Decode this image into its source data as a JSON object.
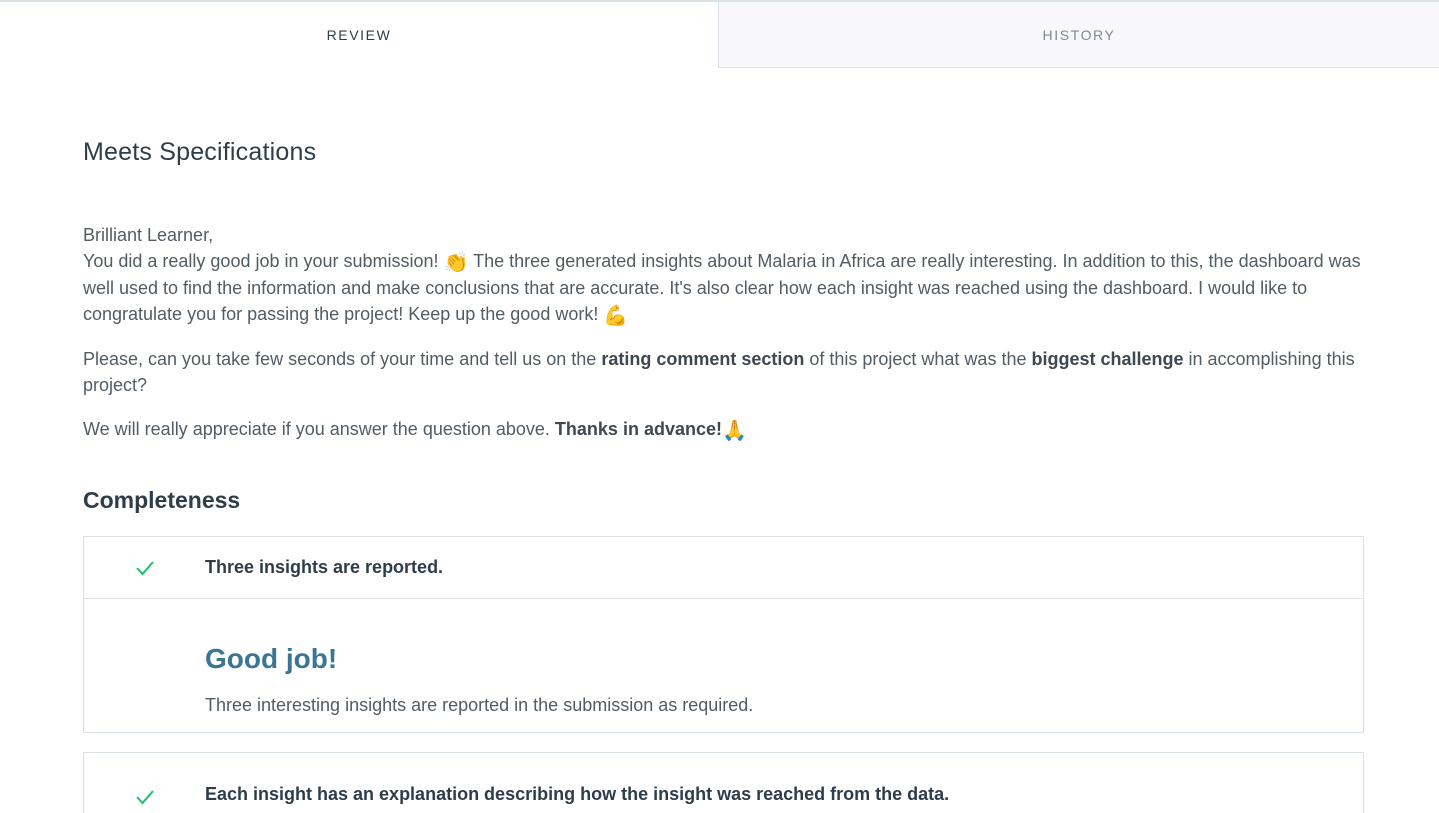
{
  "tabs": [
    {
      "label": "REVIEW",
      "active": true
    },
    {
      "label": "HISTORY",
      "active": false
    }
  ],
  "review": {
    "heading": "Meets Specifications",
    "greeting": "Brilliant Learner,",
    "para1_part1": "You did a really good job in your submission! ",
    "para1_emoji1": "👏",
    "para1_part2": " The three generated insights about Malaria in Africa are really interesting. In addition to this, the dashboard was well used to find the information and make conclusions that are accurate. It's also clear how each insight was reached using the dashboard. I would like to congratulate you for passing the project! Keep up the good work! ",
    "para1_emoji2": "💪",
    "para2_part1": "Please, can you take few seconds of your time and tell us on the ",
    "para2_bold1": "rating comment section",
    "para2_part2": " of this project what was the ",
    "para2_bold2": "biggest challenge",
    "para2_part3": " in accomplishing this project?",
    "para3_part1": "We will really appreciate if you answer the question above. ",
    "para3_bold": "Thanks in advance!",
    "para3_emoji": "🙏"
  },
  "completeness": {
    "title": "Completeness",
    "items": [
      {
        "status_icon": "check-icon",
        "text": "Three insights are reported.",
        "feedback_title": "Good job!",
        "feedback_text": "Three interesting insights are reported in the submission as required."
      },
      {
        "status_icon": "check-icon",
        "text": "Each insight has an explanation describing how the insight was reached from the data."
      }
    ]
  },
  "colors": {
    "check": "#02b3e4",
    "check_green": "#15c26b",
    "good_job": "#3a7692"
  }
}
